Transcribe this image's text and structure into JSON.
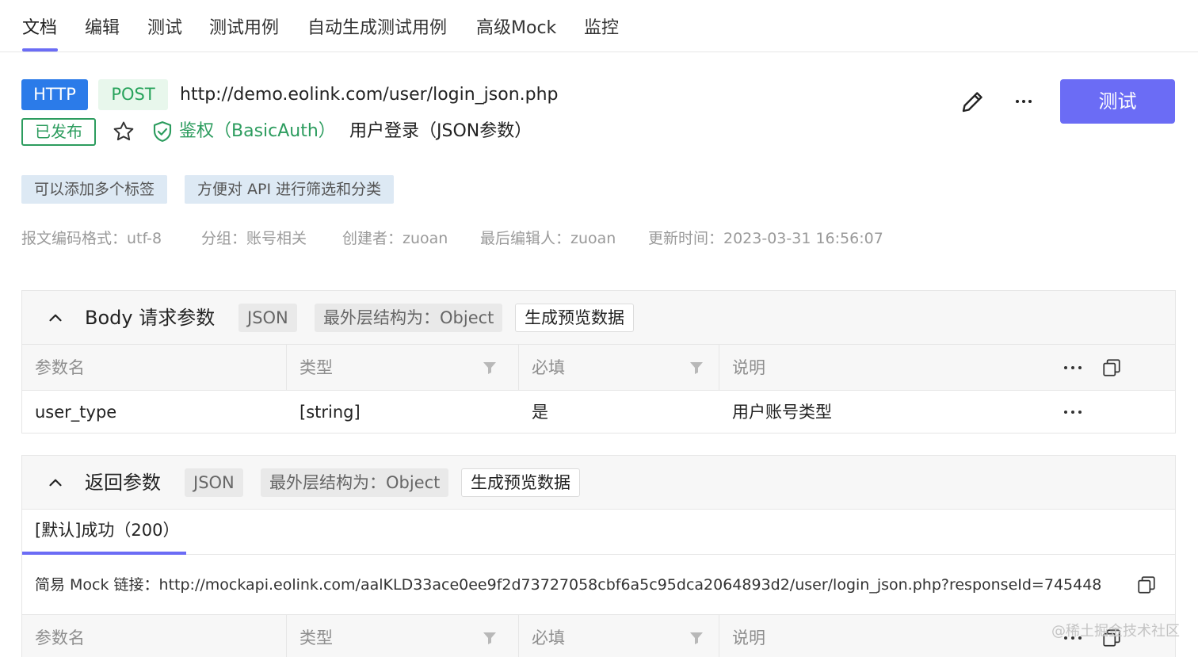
{
  "tabs": [
    "文档",
    "编辑",
    "测试",
    "测试用例",
    "自动生成测试用例",
    "高级Mock",
    "监控"
  ],
  "header": {
    "protocol": "HTTP",
    "method": "POST",
    "url": "http://demo.eolink.com/user/login_json.php",
    "status": "已发布",
    "auth": "鉴权（BasicAuth）",
    "name": "用户登录（JSON参数）",
    "test_label": "测试"
  },
  "labels": [
    "可以添加多个标签",
    "方便对 API 进行筛选和分类"
  ],
  "meta": {
    "encoding": "报文编码格式：utf-8",
    "group": "分组：账号相关",
    "creator": "创建者：zuoan",
    "editor": "最后编辑人：zuoan",
    "updated": "更新时间：2023-03-31 16:56:07"
  },
  "body_section": {
    "title": "Body 请求参数",
    "format": "JSON",
    "outer": "最外层结构为：Object",
    "preview": "生成预览数据",
    "columns": [
      "参数名",
      "类型",
      "必填",
      "说明"
    ],
    "rows": [
      {
        "name": "user_type",
        "type": "[string]",
        "required": "是",
        "desc": "用户账号类型"
      }
    ]
  },
  "response_section": {
    "title": "返回参数",
    "format": "JSON",
    "outer": "最外层结构为：Object",
    "preview": "生成预览数据",
    "tab": "[默认]成功（200）",
    "mock_link": "简易 Mock 链接：http://mockapi.eolink.com/aalKLD33ace0ee9f2d73727058cbf6a5c95dca2064893d2/user/login_json.php?responseId=745448",
    "columns": [
      "参数名",
      "类型",
      "必填",
      "说明"
    ]
  },
  "watermark": "@稀土掘金技术社区",
  "colors": {
    "accent": "#6b6cf5",
    "http": "#2b7be9",
    "post": "#27a35b",
    "published": "#2c9c5e",
    "label_bg": "#dde9f4"
  },
  "icons": [
    "star-icon",
    "shield-icon",
    "edit-icon",
    "more-icon",
    "chevron-up-icon",
    "filter-icon",
    "copy-icon"
  ]
}
